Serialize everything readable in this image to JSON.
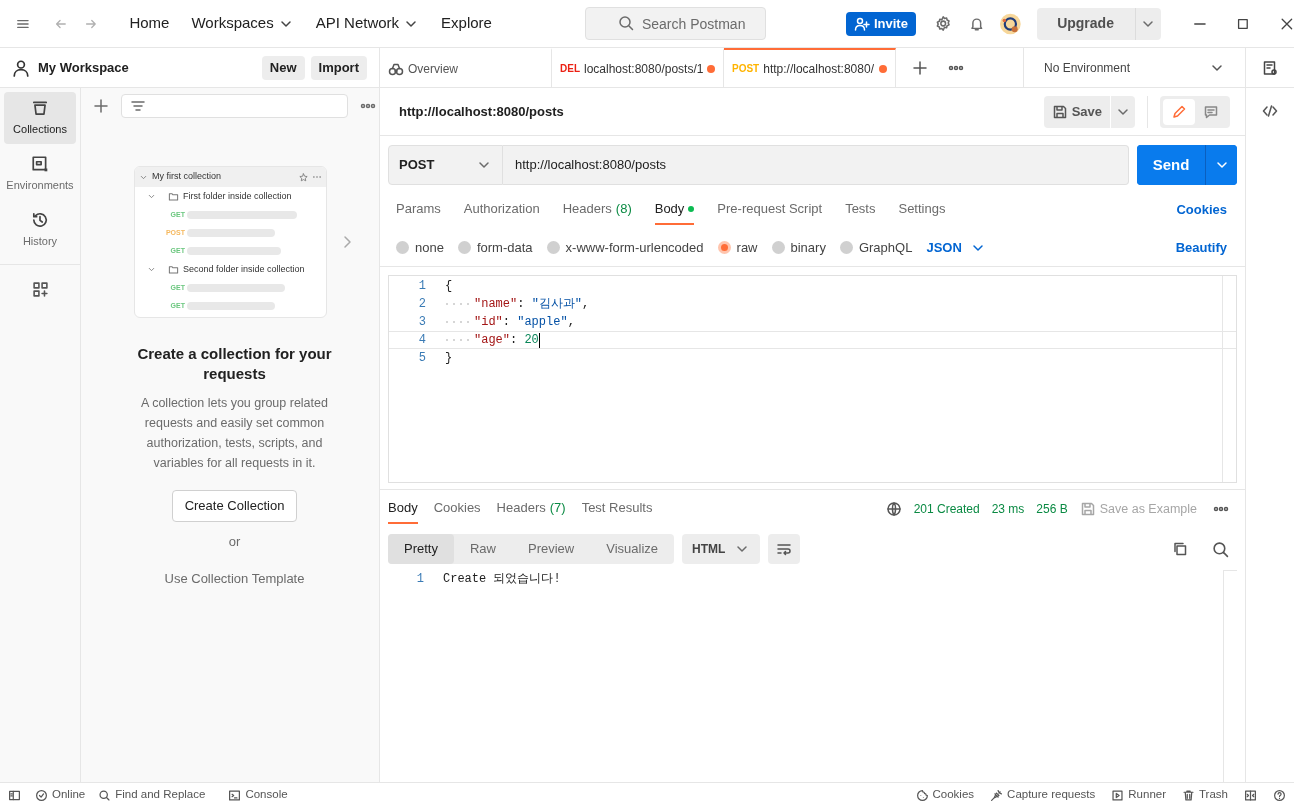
{
  "nav": {
    "items": [
      {
        "label": "Home",
        "dropdown": false
      },
      {
        "label": "Workspaces",
        "dropdown": true
      },
      {
        "label": "API Network",
        "dropdown": true
      },
      {
        "label": "Explore",
        "dropdown": false
      }
    ],
    "search_placeholder": "Search Postman",
    "invite": "Invite",
    "upgrade": "Upgrade"
  },
  "workspace": {
    "title": "My Workspace",
    "buttons": [
      "New",
      "Import"
    ]
  },
  "sidebar": {
    "items": [
      {
        "label": "Collections",
        "kind": "collections",
        "selected": true
      },
      {
        "label": "Environments",
        "kind": "environments",
        "selected": false
      },
      {
        "label": "History",
        "kind": "history",
        "selected": false
      }
    ]
  },
  "illustration": {
    "collection": "My first collection",
    "folders": [
      {
        "name": "First folder inside collection",
        "requests": [
          {
            "method": "GET",
            "color": "#6bc77f"
          },
          {
            "method": "POST",
            "color": "#f5b85e"
          },
          {
            "method": "GET",
            "color": "#6bc77f"
          }
        ]
      },
      {
        "name": "Second folder inside collection",
        "requests": [
          {
            "method": "GET",
            "color": "#6bc77f"
          },
          {
            "method": "GET",
            "color": "#6bc77f"
          }
        ]
      }
    ]
  },
  "empty_state": {
    "title": "Create a collection for your requests",
    "description": "A collection lets you group related requests and easily set common authorization, tests, scripts, and variables for all requests in it.",
    "button": "Create Collection",
    "or": "or",
    "link": "Use Collection Template"
  },
  "tabs": [
    {
      "kind": "overview",
      "label": "Overview",
      "selected": false
    },
    {
      "kind": "request",
      "method": "DEL",
      "color": "#eb2013",
      "label": "localhost:8080/posts/1",
      "unsaved": true,
      "selected": false
    },
    {
      "kind": "request",
      "method": "POST",
      "color": "#ffb400",
      "label": "http://localhost:8080/",
      "unsaved": true,
      "selected": true
    }
  ],
  "environment": "No Environment",
  "request": {
    "title": "http://localhost:8080/posts",
    "save": "Save",
    "method": "POST",
    "url": "http://localhost:8080/posts",
    "send": "Send",
    "tabs": [
      {
        "label": "Params",
        "selected": false
      },
      {
        "label": "Authorization",
        "selected": false
      },
      {
        "label": "Headers",
        "count": "(8)",
        "selected": false
      },
      {
        "label": "Body",
        "dot": true,
        "selected": true
      },
      {
        "label": "Pre-request Script",
        "selected": false
      },
      {
        "label": "Tests",
        "selected": false
      },
      {
        "label": "Settings",
        "selected": false
      }
    ],
    "cookies": "Cookies",
    "body_types": [
      {
        "label": "none",
        "selected": false
      },
      {
        "label": "form-data",
        "selected": false
      },
      {
        "label": "x-www-form-urlencoded",
        "selected": false
      },
      {
        "label": "raw",
        "selected": true
      },
      {
        "label": "binary",
        "selected": false
      },
      {
        "label": "GraphQL",
        "selected": false
      }
    ],
    "format": "JSON",
    "beautify": "Beautify",
    "code": [
      {
        "number": "1",
        "current": false,
        "tokens": [
          {
            "kind": "punct",
            "text": "{"
          }
        ],
        "children": [
          {
            "number": "2",
            "current": false,
            "tokens": [
              {
                "kind": "key",
                "text": "\"name\""
              },
              {
                "kind": "punct",
                "text": ": "
              },
              {
                "kind": "string",
                "text": "\"김사과\""
              },
              {
                "kind": "punct",
                "text": ","
              }
            ]
          },
          {
            "number": "3",
            "current": false,
            "tokens": [
              {
                "kind": "key",
                "text": "\"id\""
              },
              {
                "kind": "punct",
                "text": ": "
              },
              {
                "kind": "string",
                "text": "\"apple\""
              },
              {
                "kind": "punct",
                "text": ","
              }
            ]
          },
          {
            "number": "4",
            "current": true,
            "tokens": [
              {
                "kind": "key",
                "text": "\"age\""
              },
              {
                "kind": "punct",
                "text": ": "
              },
              {
                "kind": "number",
                "text": "20"
              }
            ]
          }
        ]
      },
      {
        "number": "5",
        "current": false,
        "tokens": [
          {
            "kind": "punct",
            "text": "}"
          }
        ]
      }
    ]
  },
  "response": {
    "tabs": [
      {
        "label": "Body",
        "selected": true
      },
      {
        "label": "Cookies",
        "selected": false
      },
      {
        "label": "Headers",
        "count": "(7)",
        "selected": false
      },
      {
        "label": "Test Results",
        "selected": false
      }
    ],
    "status": "201 Created",
    "time": "23 ms",
    "size": "256 B",
    "save_example": "Save as Example",
    "views": [
      {
        "label": "Pretty",
        "selected": true
      },
      {
        "label": "Raw",
        "selected": false
      },
      {
        "label": "Preview",
        "selected": false
      },
      {
        "label": "Visualize",
        "selected": false
      }
    ],
    "format": "HTML",
    "lines": [
      {
        "number": "1",
        "text": "Create 되었습니다!"
      }
    ]
  },
  "status_bar": {
    "left": [
      {
        "kind": "online",
        "label": "Online"
      },
      {
        "kind": "search",
        "label": "Find and Replace"
      },
      {
        "kind": "console",
        "label": "Console"
      }
    ],
    "right": [
      {
        "kind": "cookie",
        "label": "Cookies"
      },
      {
        "kind": "capture",
        "label": "Capture requests"
      },
      {
        "kind": "runner",
        "label": "Runner"
      },
      {
        "kind": "trash",
        "label": "Trash"
      }
    ]
  }
}
